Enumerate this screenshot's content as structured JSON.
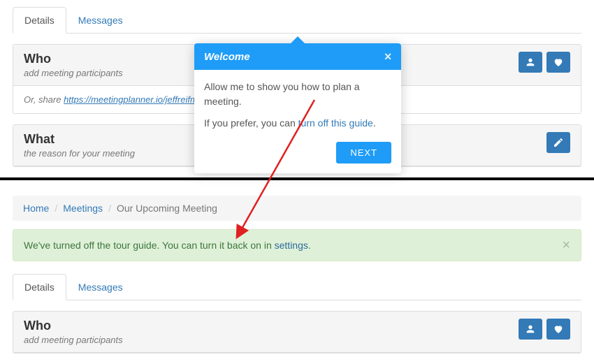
{
  "top": {
    "tabs": {
      "details": "Details",
      "messages": "Messages"
    },
    "who": {
      "title": "Who",
      "subtitle": "add meeting participants",
      "share_prefix": "Or, share ",
      "share_url": "https://meetingplanner.io/jeffreifman/4Idx"
    },
    "what": {
      "title": "What",
      "subtitle": "the reason for your meeting"
    }
  },
  "popover": {
    "title": "Welcome",
    "line1": "Allow me to show you how to plan a meeting.",
    "line2_prefix": "If you prefer, you can ",
    "line2_link": "turn off this guide",
    "line2_suffix": ".",
    "next": "NEXT"
  },
  "bottom": {
    "breadcrumb": {
      "home": "Home",
      "meetings": "Meetings",
      "current": "Our Upcoming Meeting"
    },
    "alert": {
      "text_prefix": "We've turned off the tour guide. You can turn it back on in ",
      "link": "settings",
      "text_suffix": "."
    },
    "tabs": {
      "details": "Details",
      "messages": "Messages"
    },
    "who": {
      "title": "Who",
      "subtitle": "add meeting participants"
    }
  }
}
